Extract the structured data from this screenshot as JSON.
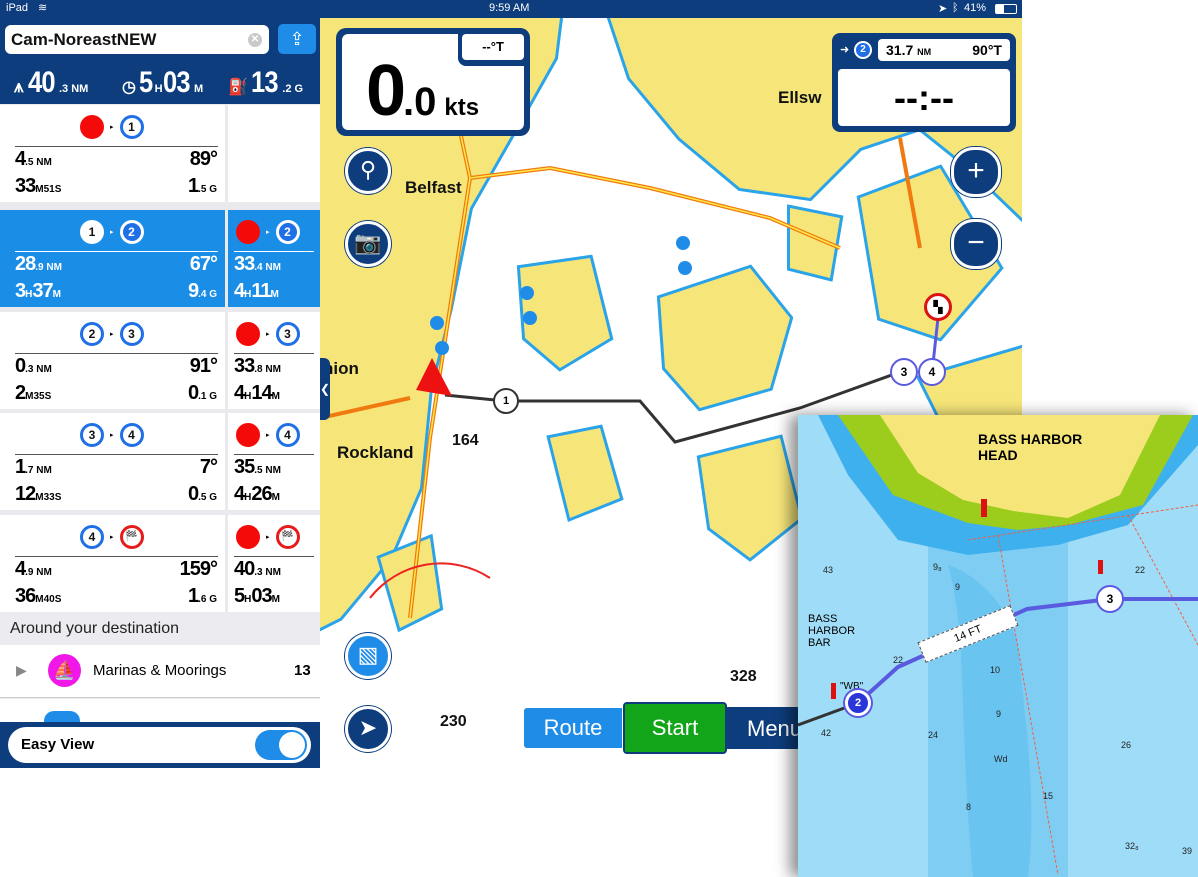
{
  "status_bar": {
    "device": "iPad",
    "time": "9:59 AM",
    "battery": "41%"
  },
  "route_panel": {
    "route_name": "Cam-NoreastNEW",
    "totals": {
      "distance": [
        [
          "40",
          "b"
        ],
        [
          ".3 NM",
          "s"
        ]
      ],
      "time": [
        [
          "5",
          "b"
        ],
        [
          "H",
          "s"
        ],
        [
          "03",
          "b"
        ],
        [
          "M",
          "s"
        ]
      ],
      "fuel": [
        [
          "13",
          "b"
        ],
        [
          ".2 G",
          "s"
        ]
      ]
    },
    "legs": [
      {
        "from": {
          "type": "start",
          "label": ""
        },
        "to": {
          "type": "wp",
          "label": "1"
        },
        "selected": false,
        "dist": [
          [
            "4",
            "b"
          ],
          [
            ".5 NM",
            "s"
          ]
        ],
        "bearing": [
          [
            "89°",
            "b"
          ]
        ],
        "time": [
          [
            "33",
            "b"
          ],
          [
            "M51S",
            "s"
          ]
        ],
        "fuel": [
          [
            "1",
            "b"
          ],
          [
            ".5 G",
            "s"
          ]
        ],
        "total": null
      },
      {
        "from": {
          "type": "wp",
          "label": "1"
        },
        "to": {
          "type": "wp",
          "label": "2"
        },
        "selected": true,
        "dist": [
          [
            "28",
            "b"
          ],
          [
            ".9 NM",
            "s"
          ]
        ],
        "bearing": [
          [
            "67°",
            "b"
          ]
        ],
        "time": [
          [
            "3",
            "b"
          ],
          [
            "H",
            "s"
          ],
          [
            "37",
            "b"
          ],
          [
            "M",
            "s"
          ]
        ],
        "fuel": [
          [
            "9",
            "b"
          ],
          [
            ".4 G",
            "s"
          ]
        ],
        "total": {
          "to": {
            "type": "wp",
            "label": "2"
          },
          "dist": [
            [
              "33",
              "b"
            ],
            [
              ".4 NM",
              "s"
            ]
          ],
          "time": [
            [
              "4",
              "b"
            ],
            [
              "H",
              "s"
            ],
            [
              "11",
              "b"
            ],
            [
              "M",
              "s"
            ]
          ]
        }
      },
      {
        "from": {
          "type": "wp",
          "label": "2"
        },
        "to": {
          "type": "wp",
          "label": "3"
        },
        "selected": false,
        "dist": [
          [
            "0",
            "b"
          ],
          [
            ".3 NM",
            "s"
          ]
        ],
        "bearing": [
          [
            "91°",
            "b"
          ]
        ],
        "time": [
          [
            "2",
            "b"
          ],
          [
            "M35S",
            "s"
          ]
        ],
        "fuel": [
          [
            "0",
            "b"
          ],
          [
            ".1 G",
            "s"
          ]
        ],
        "total": {
          "to": {
            "type": "wp",
            "label": "3"
          },
          "dist": [
            [
              "33",
              "b"
            ],
            [
              ".8 NM",
              "s"
            ]
          ],
          "time": [
            [
              "4",
              "b"
            ],
            [
              "H",
              "s"
            ],
            [
              "14",
              "b"
            ],
            [
              "M",
              "s"
            ]
          ]
        }
      },
      {
        "from": {
          "type": "wp",
          "label": "3"
        },
        "to": {
          "type": "wp",
          "label": "4"
        },
        "selected": false,
        "dist": [
          [
            "1",
            "b"
          ],
          [
            ".7 NM",
            "s"
          ]
        ],
        "bearing": [
          [
            "7°",
            "b"
          ]
        ],
        "time": [
          [
            "12",
            "b"
          ],
          [
            "M33S",
            "s"
          ]
        ],
        "fuel": [
          [
            "0",
            "b"
          ],
          [
            ".5 G",
            "s"
          ]
        ],
        "total": {
          "to": {
            "type": "wp",
            "label": "4"
          },
          "dist": [
            [
              "35",
              "b"
            ],
            [
              ".5 NM",
              "s"
            ]
          ],
          "time": [
            [
              "4",
              "b"
            ],
            [
              "H",
              "s"
            ],
            [
              "26",
              "b"
            ],
            [
              "M",
              "s"
            ]
          ]
        }
      },
      {
        "from": {
          "type": "wp",
          "label": "4"
        },
        "to": {
          "type": "finish",
          "label": "🏁"
        },
        "selected": false,
        "dist": [
          [
            "4",
            "b"
          ],
          [
            ".9 NM",
            "s"
          ]
        ],
        "bearing": [
          [
            "159°",
            "b"
          ]
        ],
        "time": [
          [
            "36",
            "b"
          ],
          [
            "M40S",
            "s"
          ]
        ],
        "fuel": [
          [
            "1",
            "b"
          ],
          [
            ".6 G",
            "s"
          ]
        ],
        "total": {
          "to": {
            "type": "finish",
            "label": "🏁"
          },
          "dist": [
            [
              "40",
              "b"
            ],
            [
              ".3 NM",
              "s"
            ]
          ],
          "time": [
            [
              "5",
              "b"
            ],
            [
              "H",
              "s"
            ],
            [
              "03",
              "b"
            ],
            [
              "M",
              "s"
            ]
          ]
        }
      }
    ],
    "around_header": "Around your destination",
    "categories": [
      {
        "label": "Marinas & Moorings",
        "count": "13",
        "icon": "sailboat-icon",
        "color": "#f018e8"
      }
    ],
    "easy_view": {
      "label": "Easy View",
      "on": true
    }
  },
  "map": {
    "speed": {
      "value_main": "0",
      "value_dec": ".0",
      "unit": "kts",
      "heading": "--°T"
    },
    "next_wp": {
      "label": "2",
      "distance": "31.7",
      "distance_unit": "NM",
      "bearing": "90°T",
      "eta": "--:--"
    },
    "place_labels": [
      "Belfast",
      "Ellsw",
      "Rockland",
      "nion"
    ],
    "depths": [
      "164",
      "328",
      "230"
    ],
    "waypoints": [
      "1",
      "3",
      "4"
    ],
    "buttons": {
      "route": "Route",
      "start": "Start",
      "menu": "Menu"
    },
    "colors": {
      "land": "#f6e67a",
      "shallow": "#2aa3e8",
      "water": "#ffffff",
      "nav": "#0d3d7c",
      "start": "#12a51a"
    }
  },
  "inset": {
    "title_line1": "BASS HARBOR",
    "title_line2": "HEAD",
    "bar_label": [
      "BASS",
      "HARBOR",
      "BAR"
    ],
    "clearance": "14 FT",
    "buoy_label": "\"WB\"",
    "waypoints": [
      "2",
      "3"
    ],
    "soundings": [
      "43",
      "9₈",
      "9",
      "22",
      "22",
      "10",
      "9",
      "42",
      "24",
      "26",
      "Wd",
      "15",
      "8",
      "32₈",
      "39"
    ]
  }
}
